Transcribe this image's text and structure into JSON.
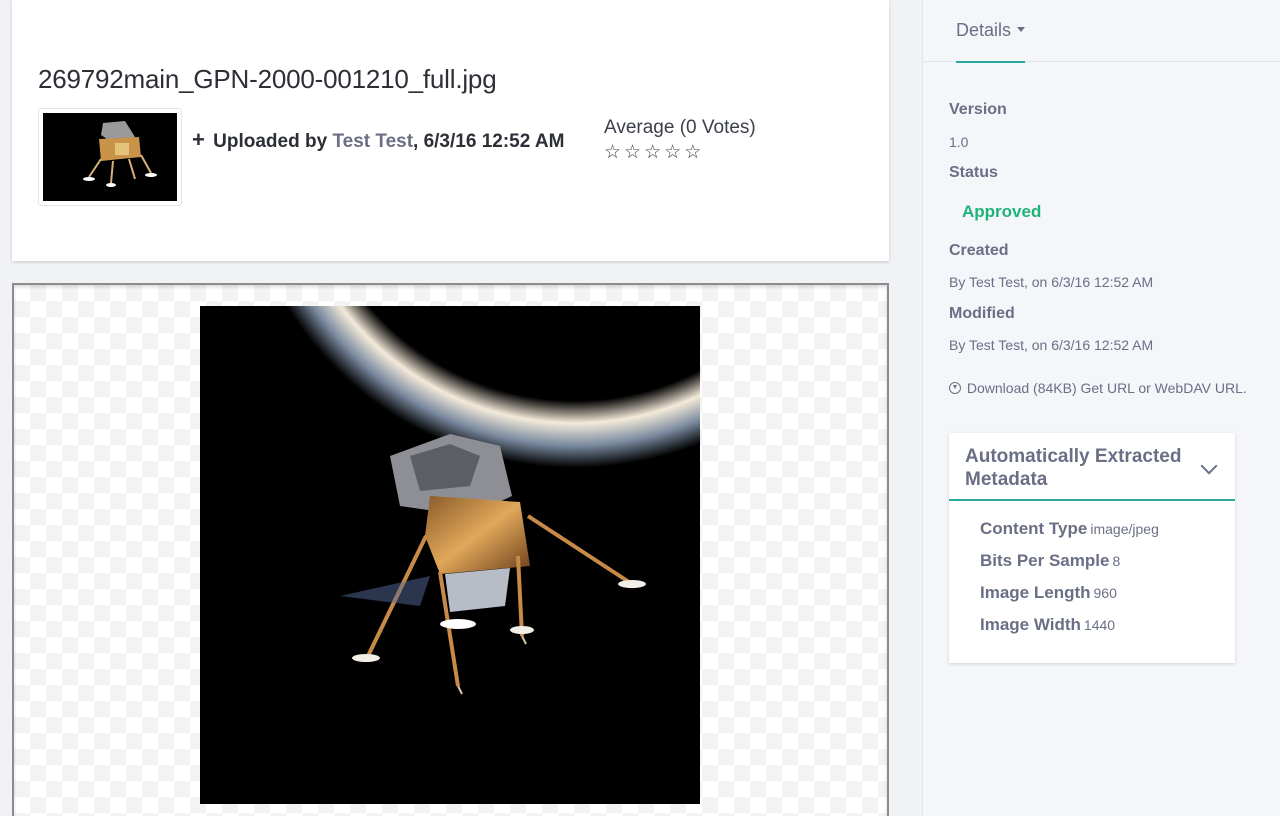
{
  "file": {
    "title": "269792main_GPN-2000-001210_full.jpg",
    "uploaded_prefix": "Uploaded by",
    "uploader": "Test Test",
    "uploaded_suffix": ", 6/3/16 12:52 AM"
  },
  "rating": {
    "label": "Average (0 Votes)",
    "stars": [
      "☆",
      "☆",
      "☆",
      "☆",
      "☆"
    ]
  },
  "sidebar": {
    "tab_label": "Details",
    "version_label": "Version",
    "version_value": "1.0",
    "status_label": "Status",
    "status_value": "Approved",
    "created_label": "Created",
    "created_value": "By Test Test, on 6/3/16 12:52 AM",
    "modified_label": "Modified",
    "modified_value": "By Test Test, on 6/3/16 12:52 AM",
    "download_text": "Download (84KB) Get URL or WebDAV URL."
  },
  "metadata_panel": {
    "title": "Automatically Extracted Metadata",
    "rows": [
      {
        "key": "Content Type",
        "value": "image/jpeg"
      },
      {
        "key": "Bits Per Sample",
        "value": "8"
      },
      {
        "key": "Image Length",
        "value": "960"
      },
      {
        "key": "Image Width",
        "value": "1440"
      }
    ]
  },
  "colors": {
    "accent": "#2aa9a0",
    "approved": "#1fb27a",
    "muted_text": "#6b6f86"
  }
}
